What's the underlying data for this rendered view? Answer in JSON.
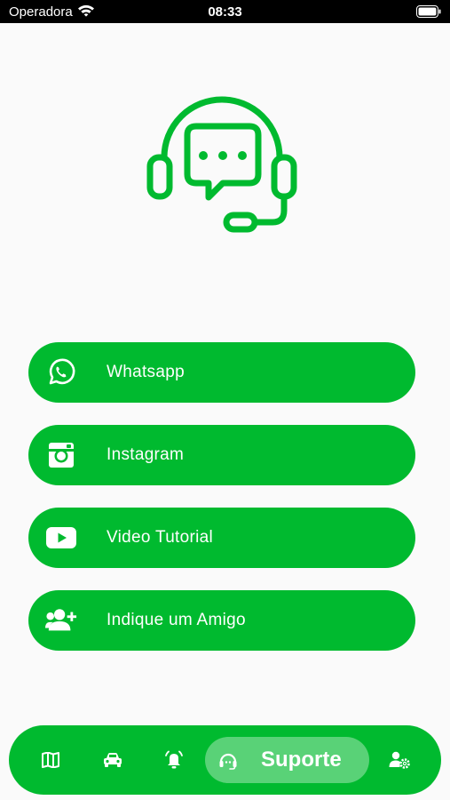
{
  "status_bar": {
    "carrier": "Operadora",
    "time": "08:33"
  },
  "hero": {
    "icon": "headset-chat-icon"
  },
  "colors": {
    "accent": "#00ba2f",
    "background": "#fafafa"
  },
  "support_options": [
    {
      "label": "Whatsapp",
      "icon": "whatsapp-icon"
    },
    {
      "label": "Instagram",
      "icon": "instagram-icon"
    },
    {
      "label": "Video Tutorial",
      "icon": "youtube-icon"
    },
    {
      "label": "Indique um Amigo",
      "icon": "user-plus-icon"
    }
  ],
  "bottom_nav": {
    "items": [
      {
        "icon": "map-icon"
      },
      {
        "icon": "car-icon"
      },
      {
        "icon": "alarm-bell-icon"
      },
      {
        "icon": "support-headset-icon",
        "label": "Suporte",
        "active": true
      },
      {
        "icon": "user-settings-icon"
      }
    ]
  }
}
